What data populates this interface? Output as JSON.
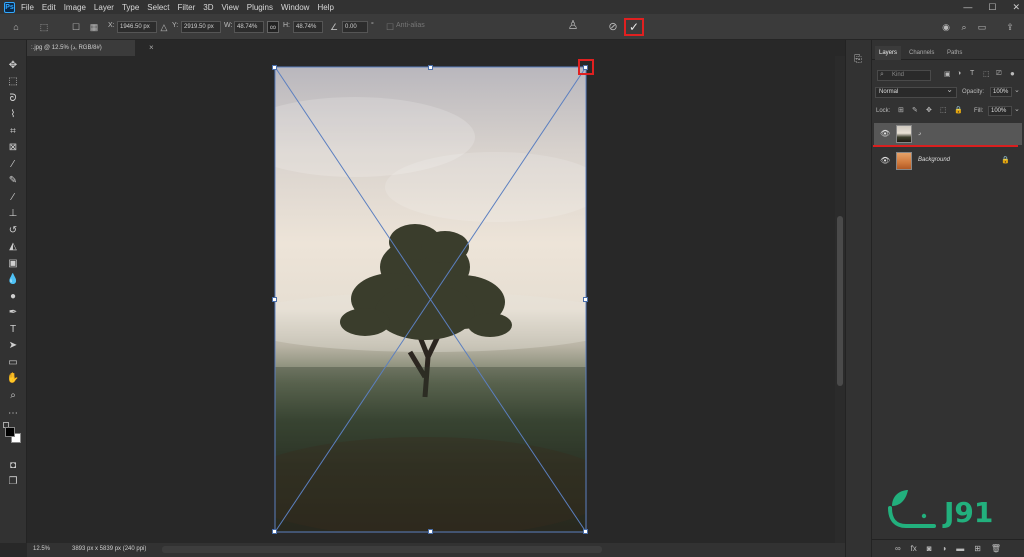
{
  "menubar": {
    "logo": "Ps",
    "items": [
      "File",
      "Edit",
      "Image",
      "Layer",
      "Type",
      "Select",
      "Filter",
      "3D",
      "View",
      "Plugins",
      "Window",
      "Help"
    ],
    "window_controls": [
      "—",
      "☐",
      "✕"
    ]
  },
  "options": {
    "x_label": "X:",
    "x_value": "1946.50 px",
    "y_label": "Y:",
    "y_value": "2919.50 px",
    "w_label": "W:",
    "w_value": "48.74%",
    "h_label": "H:",
    "h_value": "48.74%",
    "angle_value": "0.00",
    "angle_unit": "°",
    "antialias_label": "Anti-alias",
    "cancel_symbol": "⊘",
    "commit_symbol": "✓"
  },
  "document": {
    "tab_title": ":.jpg @ 12.5% (د, RGB/8#)",
    "close_symbol": "×",
    "zoom": "12.5%",
    "dimensions": "3893 px x 5839 px (240 ppi)"
  },
  "layers_panel": {
    "tabs": [
      "Layers",
      "Channels",
      "Paths"
    ],
    "kind_placeholder": "Kind",
    "blend_mode": "Normal",
    "opacity_label": "Opacity:",
    "opacity_value": "100%",
    "lock_label": "Lock:",
    "fill_label": "Fill:",
    "fill_value": "100%",
    "layers": [
      {
        "name": "د",
        "visible": true,
        "selected": true
      },
      {
        "name": "Background",
        "visible": true,
        "locked": true
      }
    ]
  },
  "watermark": {
    "text": "J91",
    "color": "#22b07d"
  },
  "colors": {
    "accent_highlight": "#e02020",
    "transform_line": "#5b7fc0"
  }
}
